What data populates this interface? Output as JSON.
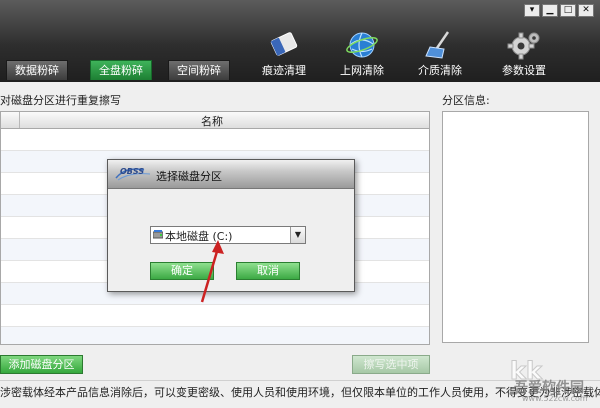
{
  "window": {
    "controls": [
      "▾",
      "▁",
      "□",
      "✕"
    ]
  },
  "tabs": [
    {
      "label": "数据粉碎",
      "active": false
    },
    {
      "label": "全盘粉碎",
      "active": true
    },
    {
      "label": "空间粉碎",
      "active": false
    }
  ],
  "tools": [
    {
      "label": "痕迹清理",
      "icon": "eraser-icon"
    },
    {
      "label": "上网清除",
      "icon": "globe-icon"
    },
    {
      "label": "介质清除",
      "icon": "broom-icon"
    },
    {
      "label": "参数设置",
      "icon": "gear-icon"
    }
  ],
  "main": {
    "left_title": "对磁盘分区进行重复擦写",
    "right_title": "分区信息:",
    "table": {
      "columns": [
        "",
        "名称"
      ],
      "rows": []
    },
    "add_button": "添加磁盘分区",
    "start_button": "擦写选中项"
  },
  "dialog": {
    "logo_text": "OBSS",
    "title": "选择磁盘分区",
    "selected": "本地磁盘 (C:)",
    "ok": "确定",
    "cancel": "取消"
  },
  "status": "涉密载体经本产品信息消除后，可以变更密级、使用人员和使用环境，但仅限本单位的工作人员使用，不得变更为非涉密载体使用。",
  "watermark": {
    "line1": "吾爱软件园",
    "line2": "www.52zcw.com"
  },
  "colors": {
    "accent_green": "#35a83d",
    "toolbar_dark": "#2e2e2e",
    "arrow_red": "#cc2222"
  }
}
